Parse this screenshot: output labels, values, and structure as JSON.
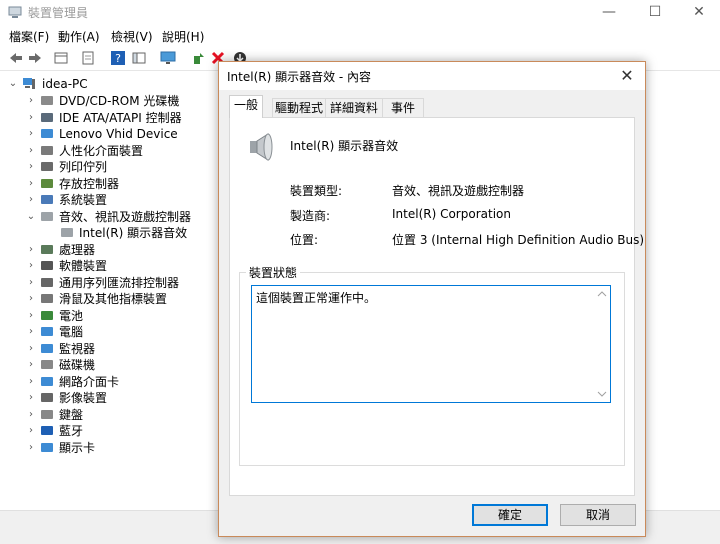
{
  "window": {
    "title": "裝置管理員"
  },
  "menu": [
    "檔案(F)",
    "動作(A)",
    "檢視(V)",
    "說明(H)"
  ],
  "tree": {
    "root": "idea-PC",
    "items": [
      {
        "label": "DVD/CD-ROM 光碟機",
        "icon": "disc-drive-icon",
        "expanded": false
      },
      {
        "label": "IDE ATA/ATAPI 控制器",
        "icon": "ide-controller-icon",
        "expanded": false
      },
      {
        "label": "Lenovo Vhid Device",
        "icon": "monitor-device-icon",
        "expanded": false
      },
      {
        "label": "人性化介面裝置",
        "icon": "hid-icon",
        "expanded": false
      },
      {
        "label": "列印佇列",
        "icon": "printer-icon",
        "expanded": false
      },
      {
        "label": "存放控制器",
        "icon": "storage-controller-icon",
        "expanded": false
      },
      {
        "label": "系統裝置",
        "icon": "system-device-icon",
        "expanded": false
      },
      {
        "label": "音效、視訊及遊戲控制器",
        "icon": "speaker-icon",
        "expanded": true
      },
      {
        "label": "Intel(R) 顯示器音效",
        "icon": "speaker-icon",
        "child": true
      },
      {
        "label": "處理器",
        "icon": "processor-icon",
        "expanded": false
      },
      {
        "label": "軟體裝置",
        "icon": "software-device-icon",
        "expanded": false
      },
      {
        "label": "通用序列匯流排控制器",
        "icon": "usb-icon",
        "expanded": false
      },
      {
        "label": "滑鼠及其他指標裝置",
        "icon": "mouse-icon",
        "expanded": false
      },
      {
        "label": "電池",
        "icon": "battery-icon",
        "expanded": false
      },
      {
        "label": "電腦",
        "icon": "computer-icon",
        "expanded": false
      },
      {
        "label": "監視器",
        "icon": "monitor-icon",
        "expanded": false
      },
      {
        "label": "磁碟機",
        "icon": "disk-drive-icon",
        "expanded": false
      },
      {
        "label": "網路介面卡",
        "icon": "network-adapter-icon",
        "expanded": false
      },
      {
        "label": "影像裝置",
        "icon": "camera-icon",
        "expanded": false
      },
      {
        "label": "鍵盤",
        "icon": "keyboard-icon",
        "expanded": false
      },
      {
        "label": "藍牙",
        "icon": "bluetooth-icon",
        "expanded": false
      },
      {
        "label": "顯示卡",
        "icon": "display-adapter-icon",
        "expanded": false
      }
    ]
  },
  "dialog": {
    "title": "Intel(R) 顯示器音效 - 內容",
    "tabs": [
      "一般",
      "驅動程式",
      "詳細資料",
      "事件"
    ],
    "device_name": "Intel(R) 顯示器音效",
    "rows": [
      {
        "label": "裝置類型:",
        "value": "音效、視訊及遊戲控制器"
      },
      {
        "label": "製造商:",
        "value": "Intel(R) Corporation"
      },
      {
        "label": "位置:",
        "value": "位置 3 (Internal High Definition Audio Bus)"
      }
    ],
    "status_legend": "裝置狀態",
    "status_text": "這個裝置正常運作中。",
    "ok_label": "確定",
    "cancel_label": "取消"
  },
  "colors": {
    "accent": "#0078d7",
    "dialog_border": "#c98a5a",
    "delete_red": "#e81123"
  }
}
